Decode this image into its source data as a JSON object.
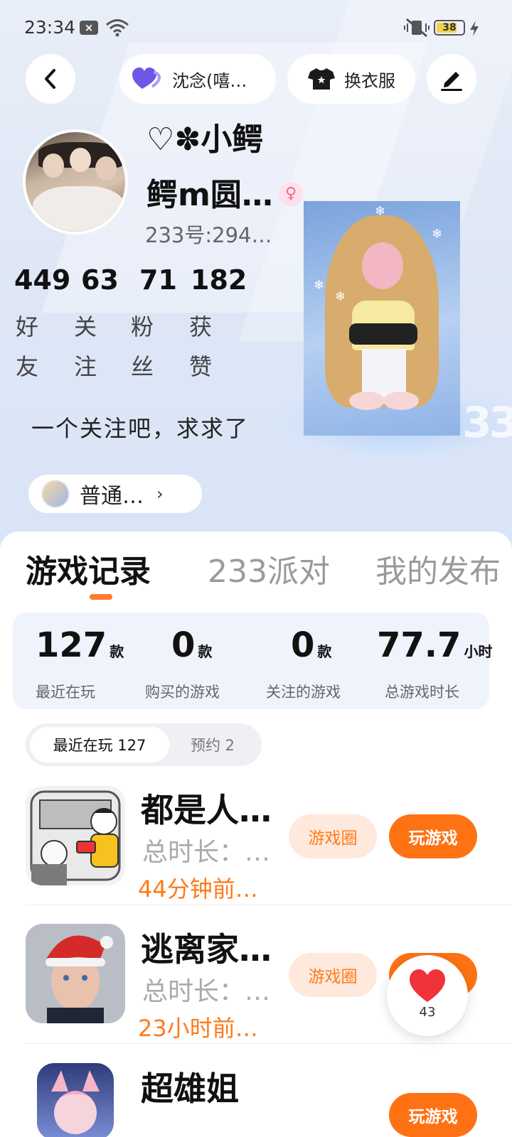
{
  "status_bar": {
    "time": "23:34",
    "battery": "38"
  },
  "nav": {
    "mood_label": "沈念(嘻…",
    "dress_label": "换衣服"
  },
  "profile": {
    "name_line1": "♡✽小鳄",
    "name_line2": "鳄m圆…",
    "gender_symbol": "♀",
    "uid": "233号:294…",
    "stats": [
      {
        "value": "449",
        "label": "好友"
      },
      {
        "value": "63",
        "label": "关注"
      },
      {
        "value": "71",
        "label": "粉丝"
      },
      {
        "value": "182",
        "label": "获赞"
      }
    ],
    "bio": "一个关注吧，求求了",
    "badge_label": "普通…",
    "badge_chevron": "›"
  },
  "tabs": [
    {
      "label": "游戏记录",
      "active": true
    },
    {
      "label": "233派对",
      "active": false
    },
    {
      "label": "我的发布",
      "active": false
    }
  ],
  "game_stats": [
    {
      "value": "127",
      "unit": "款",
      "label": "最近在玩"
    },
    {
      "value": "0",
      "unit": "款",
      "label": "购买的游戏"
    },
    {
      "value": "0",
      "unit": "款",
      "label": "关注的游戏"
    },
    {
      "value": "77.7",
      "unit": "小时",
      "label": "总游戏时长"
    }
  ],
  "segments": {
    "recent": "最近在玩 127",
    "reserved": "预约 2"
  },
  "games": [
    {
      "title": "都是人…",
      "duration": "总时长：…",
      "last_played": "44分钟前…",
      "circle_label": "游戏圈",
      "play_label": "玩游戏"
    },
    {
      "title": "逃离家…",
      "duration": "总时长：…",
      "last_played": "23小时前…",
      "circle_label": "游戏圈",
      "play_label": "玩游戏"
    },
    {
      "title": "超雄姐",
      "play_label": "玩游戏"
    }
  ],
  "like_fab": {
    "count": "43"
  },
  "colors": {
    "accent_orange": "#ff7214",
    "circle_bg": "#ffe9dc",
    "hero_bg": "#dfe7f6",
    "female_pink": "#f06a93"
  }
}
